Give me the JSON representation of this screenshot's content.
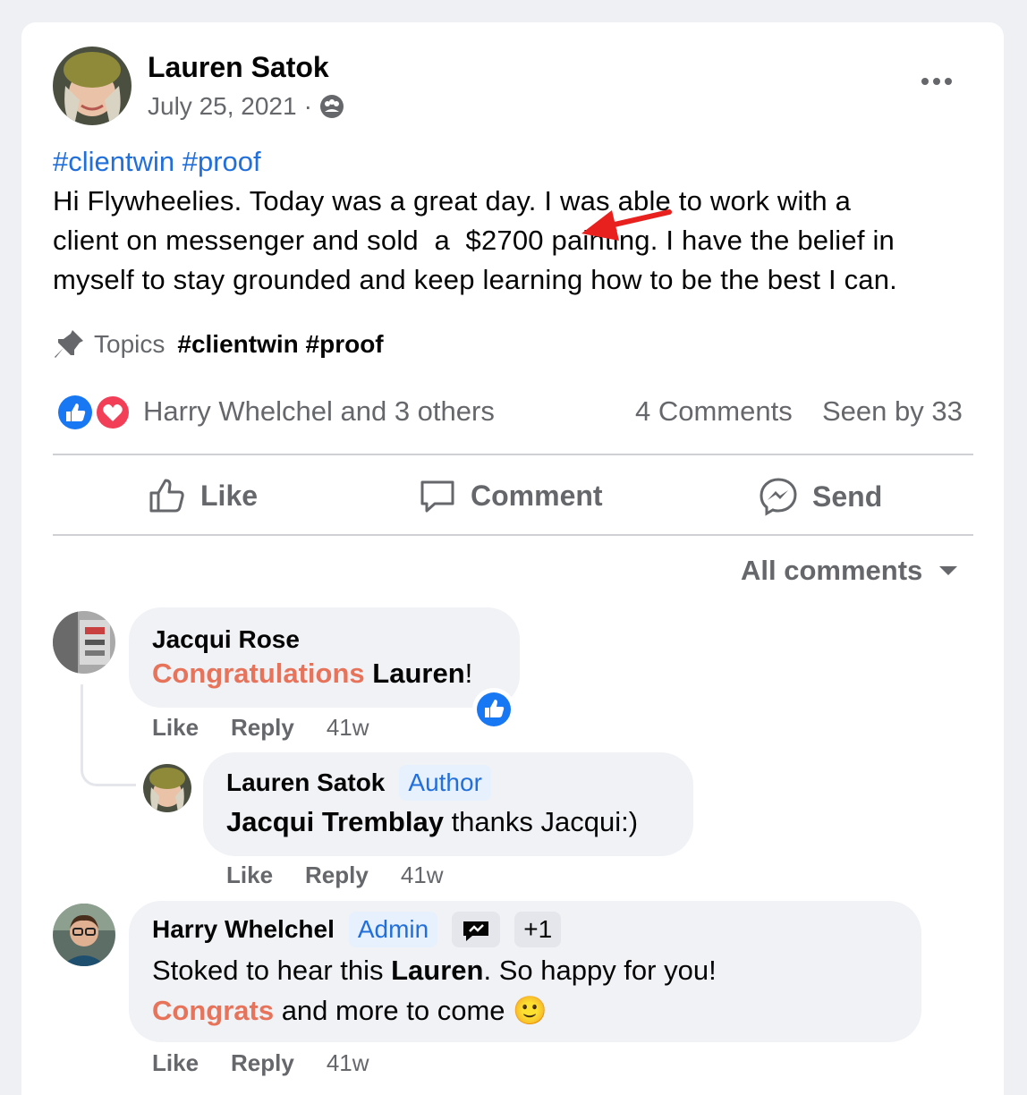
{
  "post": {
    "author": "Lauren Satok",
    "date": "July 25, 2021",
    "date_sep": "·",
    "audience_icon": "group-icon",
    "more_icon": "more-horizontal-icon",
    "hashtags": "#clientwin #proof",
    "body_line1": "Hi Flywheelies. Today was a great day. I was able to work with a",
    "body_line2": "client on messenger and sold  a  $2700 painting. I have the belief in",
    "body_line3": "myself to stay grounded and keep learning how to be the best I can.",
    "topics_label": "Topics",
    "topics_tags": "#clientwin #proof",
    "reactions_text": "Harry Whelchel and 3 others",
    "comments_count": "4 Comments",
    "seen_by": "Seen by 33"
  },
  "actions": {
    "like": "Like",
    "comment": "Comment",
    "send": "Send"
  },
  "filter": {
    "label": "All comments"
  },
  "comments": [
    {
      "author": "Jacqui Rose",
      "text_hl": "Congratulations",
      "text_bold": "Lauren",
      "text_end": "!",
      "like": "Like",
      "reply": "Reply",
      "time": "41w"
    },
    {
      "author": "Lauren Satok",
      "badge": "Author",
      "text_bold": "Jacqui Tremblay",
      "text_rest": " thanks Jacqui:)",
      "like": "Like",
      "reply": "Reply",
      "time": "41w"
    },
    {
      "author": "Harry Whelchel",
      "badge": "Admin",
      "badge_extra": "+1",
      "text_a": "Stoked to hear this ",
      "text_bold": "Lauren",
      "text_b": ". So happy for you!",
      "text_hl": "Congrats",
      "text_c": " and more to come ",
      "emoji": "🙂",
      "like": "Like",
      "reply": "Reply",
      "time": "41w"
    }
  ],
  "colors": {
    "link": "#216fdb",
    "highlight": "#e8735b",
    "like_blue": "#1877f2",
    "love_red": "#f33e58",
    "arrow_red": "#e8201e"
  }
}
